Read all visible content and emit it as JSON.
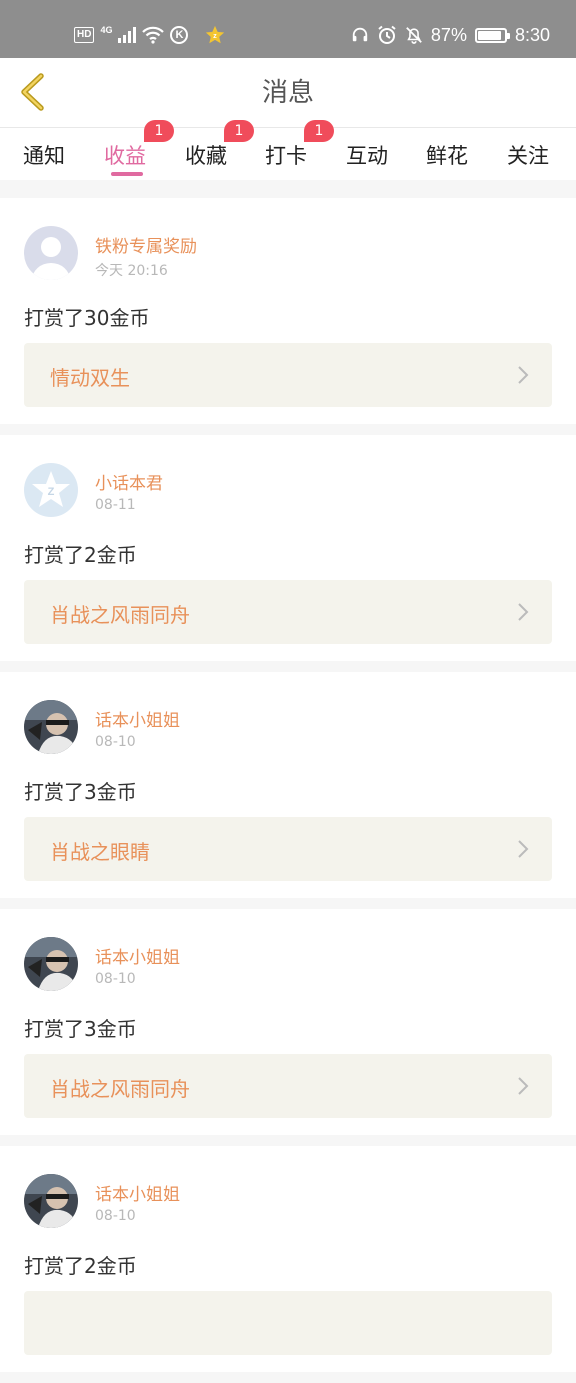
{
  "status_bar": {
    "hd": "HD",
    "network": "4G",
    "k_icon": "K",
    "battery": "87%",
    "time": "8:30",
    "battery_level": 0.87
  },
  "header": {
    "title": "消息",
    "back_icon": "chevron-left-icon"
  },
  "tabs": [
    {
      "label": "通知",
      "badge": ""
    },
    {
      "label": "收益",
      "badge": "1",
      "active": true
    },
    {
      "label": "收藏",
      "badge": "1"
    },
    {
      "label": "打卡",
      "badge": "1"
    },
    {
      "label": "互动",
      "badge": ""
    },
    {
      "label": "鲜花",
      "badge": ""
    },
    {
      "label": "关注",
      "badge": ""
    }
  ],
  "messages": [
    {
      "user": "铁粉专属奖励",
      "time": "今天 20:16",
      "text": "打赏了30金币",
      "story": "情动双生",
      "avatar": "default-avatar"
    },
    {
      "user": "小话本君",
      "time": "08-11",
      "text": "打赏了2金币",
      "story": "肖战之风雨同舟",
      "avatar": "logo-avatar"
    },
    {
      "user": "话本小姐姐",
      "time": "08-10",
      "text": "打赏了3金币",
      "story": "肖战之眼睛",
      "avatar": "photo-avatar"
    },
    {
      "user": "话本小姐姐",
      "time": "08-10",
      "text": "打赏了3金币",
      "story": "肖战之风雨同舟",
      "avatar": "photo-avatar"
    },
    {
      "user": "话本小姐姐",
      "time": "08-10",
      "text": "打赏了2金币",
      "story": "",
      "avatar": "photo-avatar"
    }
  ],
  "colors": {
    "accent_pink": "#e06aa0",
    "username_orange": "#e8915a",
    "badge_red": "#f04c5b",
    "status_bar": "#8e8e8e"
  }
}
